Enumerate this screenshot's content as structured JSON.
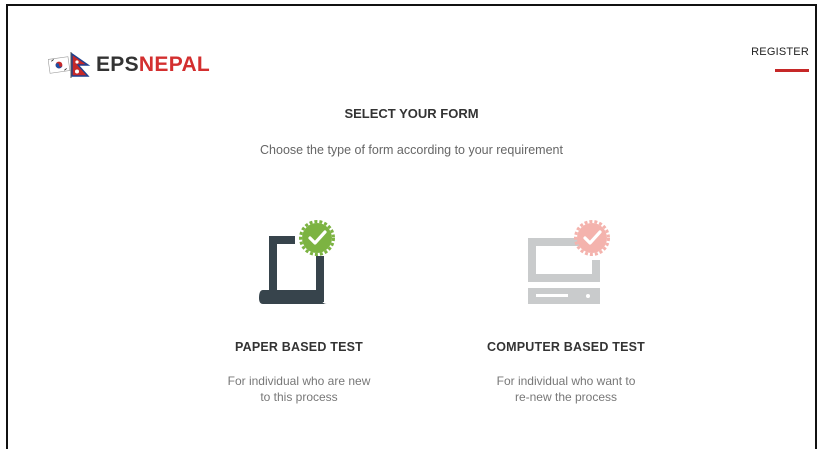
{
  "header": {
    "logo_part1": "EPS",
    "logo_part2": "NEPAL",
    "register_label": "REGISTER"
  },
  "main": {
    "title": "SELECT YOUR FORM",
    "subtitle": "Choose the type of form according to your requirement",
    "options": [
      {
        "title": "PAPER BASED TEST",
        "description": "For individual who are new\nto this process",
        "icon": "paper-test-icon"
      },
      {
        "title": "COMPUTER BASED TEST",
        "description": "For individual who want to\nre-new the process",
        "icon": "computer-test-icon"
      }
    ]
  },
  "colors": {
    "brand_red": "#d32f2f",
    "check_green": "#7cb342",
    "check_pink": "#f4b3ad",
    "icon_dark": "#37444c",
    "icon_gray": "#c9cbcc"
  }
}
